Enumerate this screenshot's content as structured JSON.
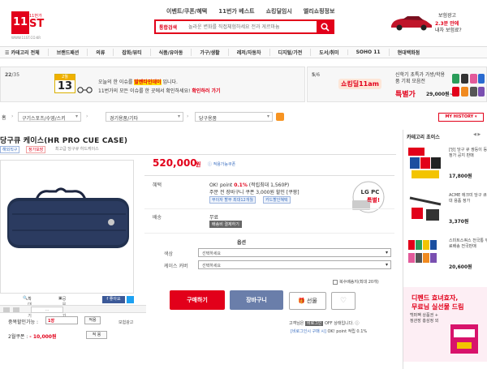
{
  "header": {
    "logo_main": "11",
    "logo_suffix": "ST",
    "logo_small": "11번가",
    "logo_url": "WWW.11ST.CO.KR",
    "nav": [
      "이벤트/쿠폰/혜택",
      "11번가 베스트",
      "쇼킹딜임시",
      "엘리쇼핑정보"
    ],
    "search_category": "통합검색",
    "search_placeholder": "놀라운 변화를 직접체험하세요 전과 게르마늄",
    "ad_line1": "보험광고",
    "ad_line2": "2.3분 만에",
    "ad_line3": "내차 보험료?"
  },
  "categories": [
    "카테고리 전체",
    "브랜드패션",
    "의류",
    "잡화/뷰티",
    "식품/유아동",
    "가구/생활",
    "레저/자동차",
    "디지털/가전",
    "도서/취미",
    "SOHO 11",
    "현대백화점"
  ],
  "promo": {
    "left_index": "22",
    "left_total": "35",
    "cal_month": "2월",
    "cal_day": "13",
    "line1_prefix": "오늘의 한 이슈를",
    "line1_highlight": "발렌타인데이",
    "line1_suffix": "입니다.",
    "line2_prefix": "11번가의 모든 이슈를 한 곳에서 확인하세요!",
    "line2_link": "확인하러 가기",
    "right_index": "5",
    "right_total": "6",
    "right_logo": "쇼킹딜11am",
    "right_text": "신학기 초특가 가방/학용품 기획 모음전",
    "right_sale": "특별가",
    "right_price": "29,000원~"
  },
  "breadcrumb": {
    "home": "홈",
    "levels": [
      "구기스포츠/수영/스키",
      "경기용품/기타",
      "당구용품"
    ],
    "my_history": "MY HISTORY ▾"
  },
  "product": {
    "title": "당구큐 케이스(HR PRO CUE CASE)",
    "badge1": "해외직구",
    "badge2": "정가보장",
    "subtitle": "최고급 당구큐 하드케이스",
    "price": "520,000",
    "price_unit": "원",
    "price_note": "ⓘ 적용가능쿠폰",
    "benefit_label": "혜택",
    "benefit_line1_a": "OK! point",
    "benefit_line1_b": "0.1%",
    "benefit_line1_c": "(적립최대 1,560P)",
    "benefit_line2": "주문 전 장바구니 쿠폰 3,000원 할인 [쿠팡]",
    "benefit_tag1": "무이자 할부 최대12개월",
    "benefit_tag2": "카드할인혜택",
    "lg_text1": "LG PC",
    "lg_text2": "특별!",
    "shipping_label": "배송",
    "shipping_value": "무료",
    "shipping_tag": "배송비 결제하기",
    "option_header": "옵션",
    "opt1_label": "색상",
    "opt1_value": "선택하세요",
    "opt2_label": "케이스 커버",
    "opt2_value": "선택하세요",
    "checkbox_label": "복수배송지(최대 20개)",
    "buy": "구매하기",
    "cart": "장바구니",
    "gift": "선물",
    "like": "♡",
    "low1": "고객님은",
    "low1_tag": "비로그인",
    "low1_b": "OFF 상태입니다. ⓘ",
    "low2": "[비로그인시 구매 시]",
    "low2_b": "OK! point 적립 0.1%"
  },
  "gallery": {
    "enlarge": "확대보기",
    "share": "공유하기",
    "facebook": "f 좋아요",
    "thumb_label": "..."
  },
  "coupons": {
    "row1_label": "중복할인가능 :",
    "row1_value": "1장",
    "row1_btn": "적용",
    "row2_label": "2월쿠폰 :",
    "row2_value": "- 10,000원",
    "row2_btn": "적 용",
    "view": "보험광고"
  },
  "rightcol": {
    "title": "카테고리 초이스",
    "nav": "◀ ▶",
    "items": [
      {
        "text": "[당] 당구 큐 쌍둥이 등 정가 공지 판매",
        "price": "17,800원"
      },
      {
        "text": "ACME 에크미 당구 큐 대 용품 정가",
        "price": "3,370원"
      },
      {
        "text": "스미트스쿼스 전국통 무료배송 전국판매",
        "price": "20,600원"
      }
    ],
    "ad_line1": "디펜드 효녀효자,",
    "ad_line2": "무료님 실선물 드림",
    "ad_sub1": "백퍼팩 상품권 +",
    "ad_sub2": "정관장 홍삼정 외"
  }
}
